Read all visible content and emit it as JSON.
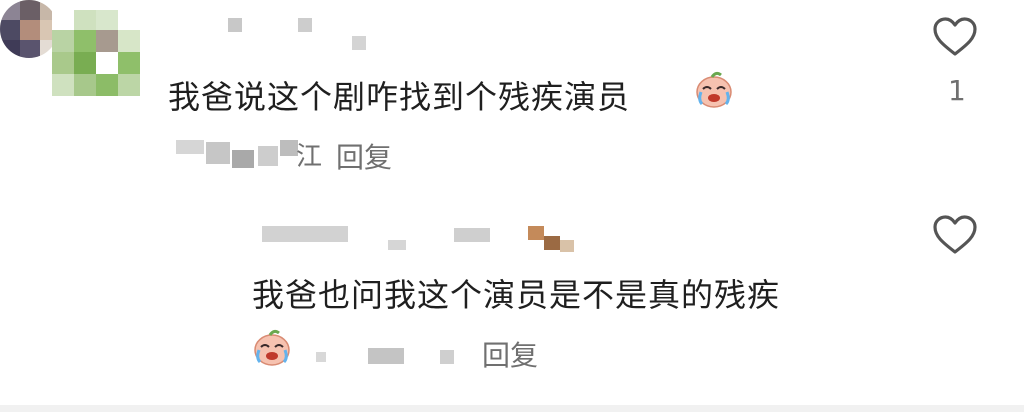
{
  "comment": {
    "text": "我爸说这个剧咋找到个残疾演员",
    "reply_label": "回复",
    "like_count": "1",
    "author_suffix": "江"
  },
  "reply": {
    "text": "我爸也问我这个演员是不是真的残疾",
    "reply_label_partial": "回复"
  },
  "icons": {
    "like": "heart-outline-icon",
    "emoji": "crying-laughing-sticker-icon"
  },
  "colors": {
    "text": "#1f1f1f",
    "meta": "#707070",
    "heart_stroke": "#555555",
    "avatar_green": "#8fbf6a"
  }
}
